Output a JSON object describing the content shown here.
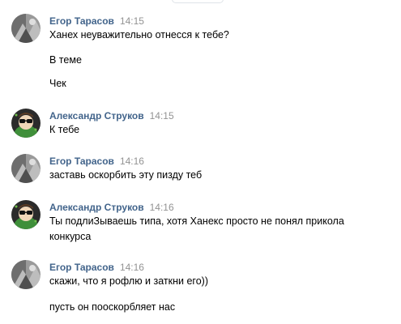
{
  "messages": [
    {
      "author": "Егор Тарасов",
      "time": "14:15",
      "lines": [
        "Ханех неуважительно отнесся к тебе?",
        "В теме",
        "Чек"
      ]
    },
    {
      "author": "Александр Струков",
      "time": "14:15",
      "lines": [
        "К тебе"
      ]
    },
    {
      "author": "Егор Тарасов",
      "time": "14:16",
      "lines": [
        "заставь оскорбить эту пизду теб"
      ]
    },
    {
      "author": "Александр Струков",
      "time": "14:16",
      "lines": [
        "Ты подлиЗываешь типа, хотя Ханекс просто не понял прикола",
        "конкурса"
      ]
    },
    {
      "author": "Егор Тарасов",
      "time": "14:16",
      "lines": [
        "скажи, что я рофлю и заткни его))",
        "пусть он пооскорбляет нас"
      ]
    }
  ]
}
